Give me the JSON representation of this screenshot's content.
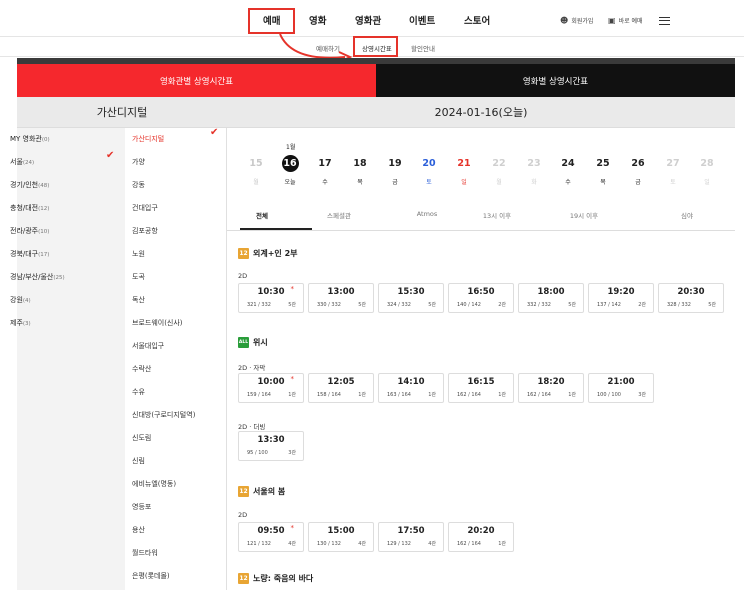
{
  "nav": {
    "items": [
      "예매",
      "영화",
      "영화관",
      "이벤트",
      "스토어"
    ],
    "signup": "회원가입",
    "quick_booking": "바로 예매"
  },
  "subnav": [
    "예매하기",
    "상영시간표",
    "할인안내"
  ],
  "tabs": {
    "by_cinema": "영화관별 상영시간표",
    "by_movie": "영화별 상영시간표"
  },
  "cinema_title": "가산디지털",
  "date_title": "2024-01-16(오늘)",
  "regions": [
    {
      "name": "MY 영화관",
      "count": "(0)"
    },
    {
      "name": "서울",
      "count": "(24)"
    },
    {
      "name": "경기/인천",
      "count": "(48)"
    },
    {
      "name": "충청/대전",
      "count": "(12)"
    },
    {
      "name": "전라/광주",
      "count": "(10)"
    },
    {
      "name": "경북/대구",
      "count": "(17)"
    },
    {
      "name": "경남/부산/울산",
      "count": "(25)"
    },
    {
      "name": "강원",
      "count": "(4)"
    },
    {
      "name": "제주",
      "count": "(3)"
    }
  ],
  "cinemas": [
    "가산디지털",
    "가양",
    "강동",
    "건대입구",
    "김포공항",
    "노원",
    "도곡",
    "독산",
    "브로드웨이(신사)",
    "서울대입구",
    "수락산",
    "수유",
    "신대방(구로디지털역)",
    "신도림",
    "신림",
    "에비뉴엘(명동)",
    "영등포",
    "용산",
    "월드타워",
    "은평(롯데몰)"
  ],
  "month_label": "1월",
  "days": [
    {
      "num": "15",
      "wd": "월",
      "kind": "past"
    },
    {
      "num": "16",
      "wd": "오늘",
      "kind": "today"
    },
    {
      "num": "17",
      "wd": "수",
      "kind": "normal"
    },
    {
      "num": "18",
      "wd": "목",
      "kind": "normal"
    },
    {
      "num": "19",
      "wd": "금",
      "kind": "normal"
    },
    {
      "num": "20",
      "wd": "토",
      "kind": "sat"
    },
    {
      "num": "21",
      "wd": "일",
      "kind": "sun"
    },
    {
      "num": "22",
      "wd": "월",
      "kind": "dim"
    },
    {
      "num": "23",
      "wd": "화",
      "kind": "dim"
    },
    {
      "num": "24",
      "wd": "수",
      "kind": "normal"
    },
    {
      "num": "25",
      "wd": "목",
      "kind": "normal"
    },
    {
      "num": "26",
      "wd": "금",
      "kind": "normal"
    },
    {
      "num": "27",
      "wd": "토",
      "kind": "dim"
    },
    {
      "num": "28",
      "wd": "일",
      "kind": "dim"
    }
  ],
  "filters": [
    "전체",
    "스페셜관",
    "Atmos",
    "13시 이후",
    "19시 이후",
    "심야"
  ],
  "movies": [
    {
      "title": "외계+인 2부",
      "grade": "12",
      "formats": [
        {
          "label": "2D",
          "slots": [
            {
              "time": "10:30",
              "seats": "321",
              "total": "/ 332",
              "hall": "5관",
              "star": "*"
            },
            {
              "time": "13:00",
              "seats": "330",
              "total": "/ 332",
              "hall": "5관"
            },
            {
              "time": "15:30",
              "seats": "324",
              "total": "/ 332",
              "hall": "5관"
            },
            {
              "time": "16:50",
              "seats": "140",
              "total": "/ 142",
              "hall": "2관"
            },
            {
              "time": "18:00",
              "seats": "332",
              "total": "/ 332",
              "hall": "5관"
            },
            {
              "time": "19:20",
              "seats": "137",
              "total": "/ 142",
              "hall": "2관"
            },
            {
              "time": "20:30",
              "seats": "328",
              "total": "/ 332",
              "hall": "5관"
            }
          ]
        }
      ]
    },
    {
      "title": "위시",
      "grade": "ALL",
      "formats": [
        {
          "label": "2D · 자막",
          "slots": [
            {
              "time": "10:00",
              "seats": "159",
              "total": "/ 164",
              "hall": "1관",
              "star": "*"
            },
            {
              "time": "12:05",
              "seats": "158",
              "total": "/ 164",
              "hall": "1관"
            },
            {
              "time": "14:10",
              "seats": "163",
              "total": "/ 164",
              "hall": "1관"
            },
            {
              "time": "16:15",
              "seats": "162",
              "total": "/ 164",
              "hall": "1관"
            },
            {
              "time": "18:20",
              "seats": "162",
              "total": "/ 164",
              "hall": "1관"
            },
            {
              "time": "21:00",
              "seats": "100",
              "total": "/ 100",
              "hall": "3관"
            }
          ]
        },
        {
          "label": "2D · 더빙",
          "slots": [
            {
              "time": "13:30",
              "seats": "95",
              "total": "/ 100",
              "hall": "3관"
            }
          ]
        }
      ]
    },
    {
      "title": "서울의 봄",
      "grade": "12",
      "formats": [
        {
          "label": "2D",
          "slots": [
            {
              "time": "09:50",
              "seats": "121",
              "total": "/ 132",
              "hall": "4관",
              "star": "*"
            },
            {
              "time": "15:00",
              "seats": "130",
              "total": "/ 132",
              "hall": "4관"
            },
            {
              "time": "17:50",
              "seats": "129",
              "total": "/ 132",
              "hall": "4관"
            },
            {
              "time": "20:20",
              "seats": "162",
              "total": "/ 164",
              "hall": "1관"
            }
          ]
        }
      ]
    },
    {
      "title": "노량: 죽음의 바다",
      "grade": "12",
      "formats": []
    }
  ],
  "colors": {
    "accent": "#f5282d",
    "annotation": "#e5332a",
    "saturday": "#2b5fd9"
  }
}
